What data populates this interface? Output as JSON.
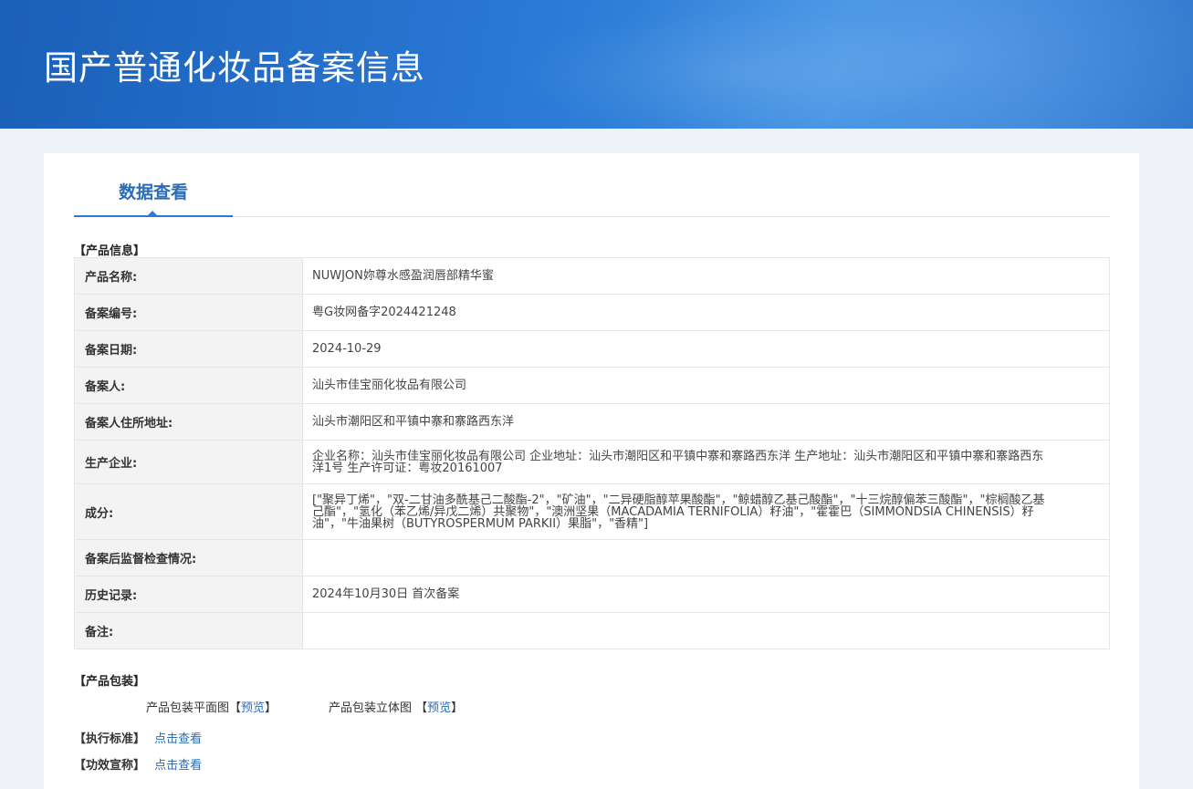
{
  "page_title": "国产普通化妆品备案信息",
  "tab": {
    "label": "数据查看"
  },
  "sections": {
    "product_info": "【产品信息】",
    "packaging": "【产品包装】",
    "standard": "【执行标准】",
    "efficacy": "【功效宣称】"
  },
  "rows": [
    {
      "key": "产品名称:",
      "value": "NUWJON妳尊水感盈润唇部精华蜜"
    },
    {
      "key": "备案编号:",
      "value": "粤G妆网备字2024421248"
    },
    {
      "key": "备案日期:",
      "value": "2024-10-29"
    },
    {
      "key": "备案人:",
      "value": "汕头市佳宝丽化妆品有限公司"
    },
    {
      "key": "备案人住所地址:",
      "value": "汕头市潮阳区和平镇中寨和寨路西东洋"
    },
    {
      "key": "生产企业:",
      "value": "企业名称：汕头市佳宝丽化妆品有限公司 企业地址：汕头市潮阳区和平镇中寨和寨路西东洋 生产地址：汕头市潮阳区和平镇中寨和寨路西东洋1号 生产许可证：粤妆20161007"
    },
    {
      "key": "成分:",
      "value": "[\"聚异丁烯\"，\"双-二甘油多酰基己二酸酯-2\"，\"矿油\"，\"二异硬脂醇苹果酸酯\"，\"鲸蜡醇乙基己酸酯\"，\"十三烷醇偏苯三酸酯\"，\"棕榈酸乙基己酯\"，\"氢化（苯乙烯/异戊二烯）共聚物\"，\"澳洲坚果（MACADAMIA TERNIFOLIA）籽油\"，\"霍霍巴（SIMMONDSIA CHINENSIS）籽油\"，\"牛油果树（BUTYROSPERMUM PARKII）果脂\"，\"香精\"]"
    },
    {
      "key": "备案后监督检查情况:",
      "value": ""
    },
    {
      "key": "历史记录:",
      "value": "2024年10月30日 首次备案"
    },
    {
      "key": "备注:",
      "value": ""
    }
  ],
  "packaging": {
    "flat_label": "产品包装平面图",
    "solid_label": "产品包装立体图",
    "bracket_open": "【",
    "bracket_open_spaced": " 【",
    "bracket_close": "】",
    "preview": "预览"
  },
  "links": {
    "view": "点击查看"
  }
}
